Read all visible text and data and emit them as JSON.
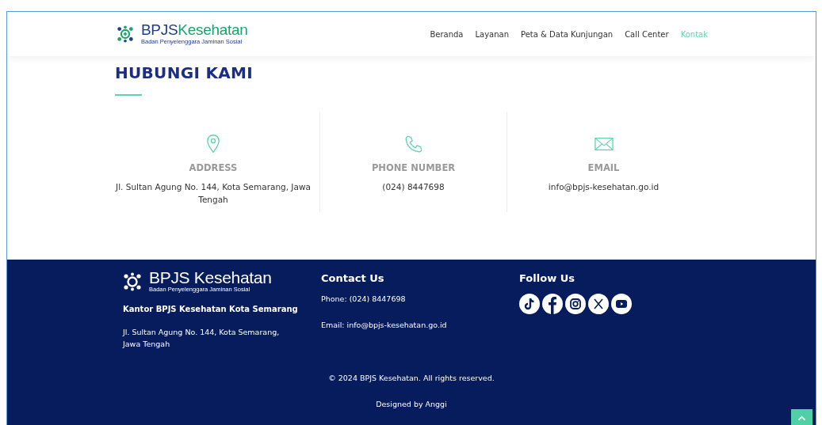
{
  "header": {
    "logo": {
      "name_a": "BPJS",
      "name_b": "Kesehatan",
      "tagline": "Badan Penyelenggara Jaminan Sosial"
    },
    "nav": [
      {
        "label": "Beranda",
        "selected": false
      },
      {
        "label": "Layanan",
        "selected": false
      },
      {
        "label": "Peta & Data Kunjungan",
        "selected": false
      },
      {
        "label": "Call Center",
        "selected": false
      },
      {
        "label": "Kontak",
        "selected": true
      }
    ]
  },
  "section": {
    "title": "HUBUNGI KAMI",
    "cards": [
      {
        "kind": "address",
        "heading": "ADDRESS",
        "text": "Jl. Sultan Agung No. 144, Kota Semarang, Jawa Tengah"
      },
      {
        "kind": "phone",
        "heading": "PHONE NUMBER",
        "text": "(024) 8447698"
      },
      {
        "kind": "email",
        "heading": "EMAIL",
        "text": "info@bpjs-kesehatan.go.id"
      }
    ]
  },
  "footer": {
    "logo": {
      "name_a": "BPJS",
      "name_b": "Kesehatan",
      "tagline": "Badan Penyelenggara Jaminan Sosial"
    },
    "office": "Kantor BPJS Kesehatan Kota Semarang",
    "address": "Jl. Sultan Agung No. 144, Kota Semarang, Jawa Tengah",
    "contact": {
      "title": "Contact Us",
      "phone": "Phone: (024) 8447698",
      "email": "Email: info@bpjs-kesehatan.go.id"
    },
    "follow": {
      "title": "Follow Us",
      "links": [
        {
          "kind": "tiktok"
        },
        {
          "kind": "facebook"
        },
        {
          "kind": "instagram"
        },
        {
          "kind": "x"
        },
        {
          "kind": "youtube"
        }
      ]
    },
    "copyright": "© 2024 BPJS Kesehatan. All rights reserved.",
    "credit": "Designed by Anggi"
  }
}
